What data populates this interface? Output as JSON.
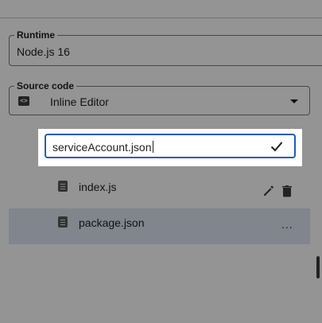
{
  "runtime": {
    "label": "Runtime",
    "value": "Node.js 16"
  },
  "source_code": {
    "label": "Source code",
    "icon": "code-icon",
    "value": "Inline Editor",
    "dropdown_icon": "chevron-down-icon"
  },
  "rename": {
    "value": "serviceAccount.json",
    "confirm_icon": "check-icon"
  },
  "files": [
    {
      "name": "index.js",
      "icon": "file-icon",
      "actions": [
        "edit-icon",
        "delete-icon"
      ]
    },
    {
      "name": "package.json",
      "icon": "file-icon",
      "more_label": "...",
      "selected": true
    }
  ],
  "colors": {
    "accent": "#1a5fb4",
    "selected_row": "#dfe5f3",
    "scrim": "rgba(0,0,0,0.42)"
  }
}
